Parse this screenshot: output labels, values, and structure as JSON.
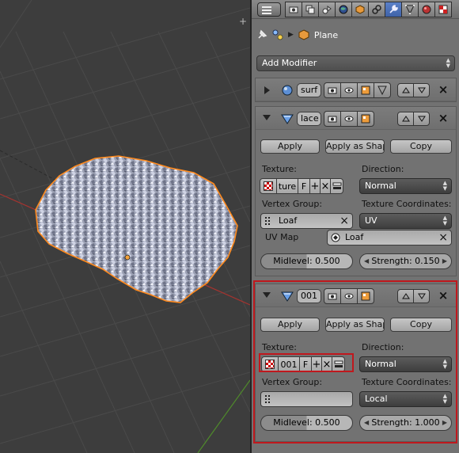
{
  "colors": {
    "accent": "#5277c3",
    "highlight": "#c0181d",
    "mesh_edge": "#ff8a1d",
    "grid_x_axis": "#a5332f",
    "grid_y_axis": "#4f8a2b"
  },
  "header": {
    "context_tabs": [
      "render-icon",
      "render-layers-icon",
      "scene-icon",
      "world-icon",
      "object-icon",
      "constraints-icon",
      "modifiers-icon",
      "data-icon",
      "material-icon",
      "texture-icon"
    ],
    "active_tab": "modifiers-icon"
  },
  "breadcrumb": {
    "object": "Plane"
  },
  "add_modifier": {
    "label": "Add Modifier"
  },
  "modifiers": {
    "surf": {
      "name": "surf"
    },
    "lace": {
      "name": "lace",
      "apply": "Apply",
      "apply_as_shape": "Apply as Shap",
      "copy": "Copy",
      "texture_label": "Texture:",
      "texture_name": "ture",
      "texture_f": "F",
      "direction_label": "Direction:",
      "direction_value": "Normal",
      "vgroup_label": "Vertex Group:",
      "vgroup_value": "Loaf",
      "texcoords_label": "Texture Coordinates:",
      "texcoords_value": "UV",
      "uvmap_label": "UV Map",
      "uvmap_value": "Loaf",
      "midlevel": "Midlevel: 0.500",
      "strength": "Strength: 0.150"
    },
    "d001": {
      "name": "001",
      "apply": "Apply",
      "apply_as_shape": "Apply as Shap",
      "copy": "Copy",
      "texture_label": "Texture:",
      "texture_name": "001",
      "texture_f": "F",
      "direction_label": "Direction:",
      "direction_value": "Normal",
      "vgroup_label": "Vertex Group:",
      "vgroup_value": "",
      "texcoords_label": "Texture Coordinates:",
      "texcoords_value": "Local",
      "midlevel": "Midlevel: 0.500",
      "strength": "Strength: 1.000"
    }
  }
}
